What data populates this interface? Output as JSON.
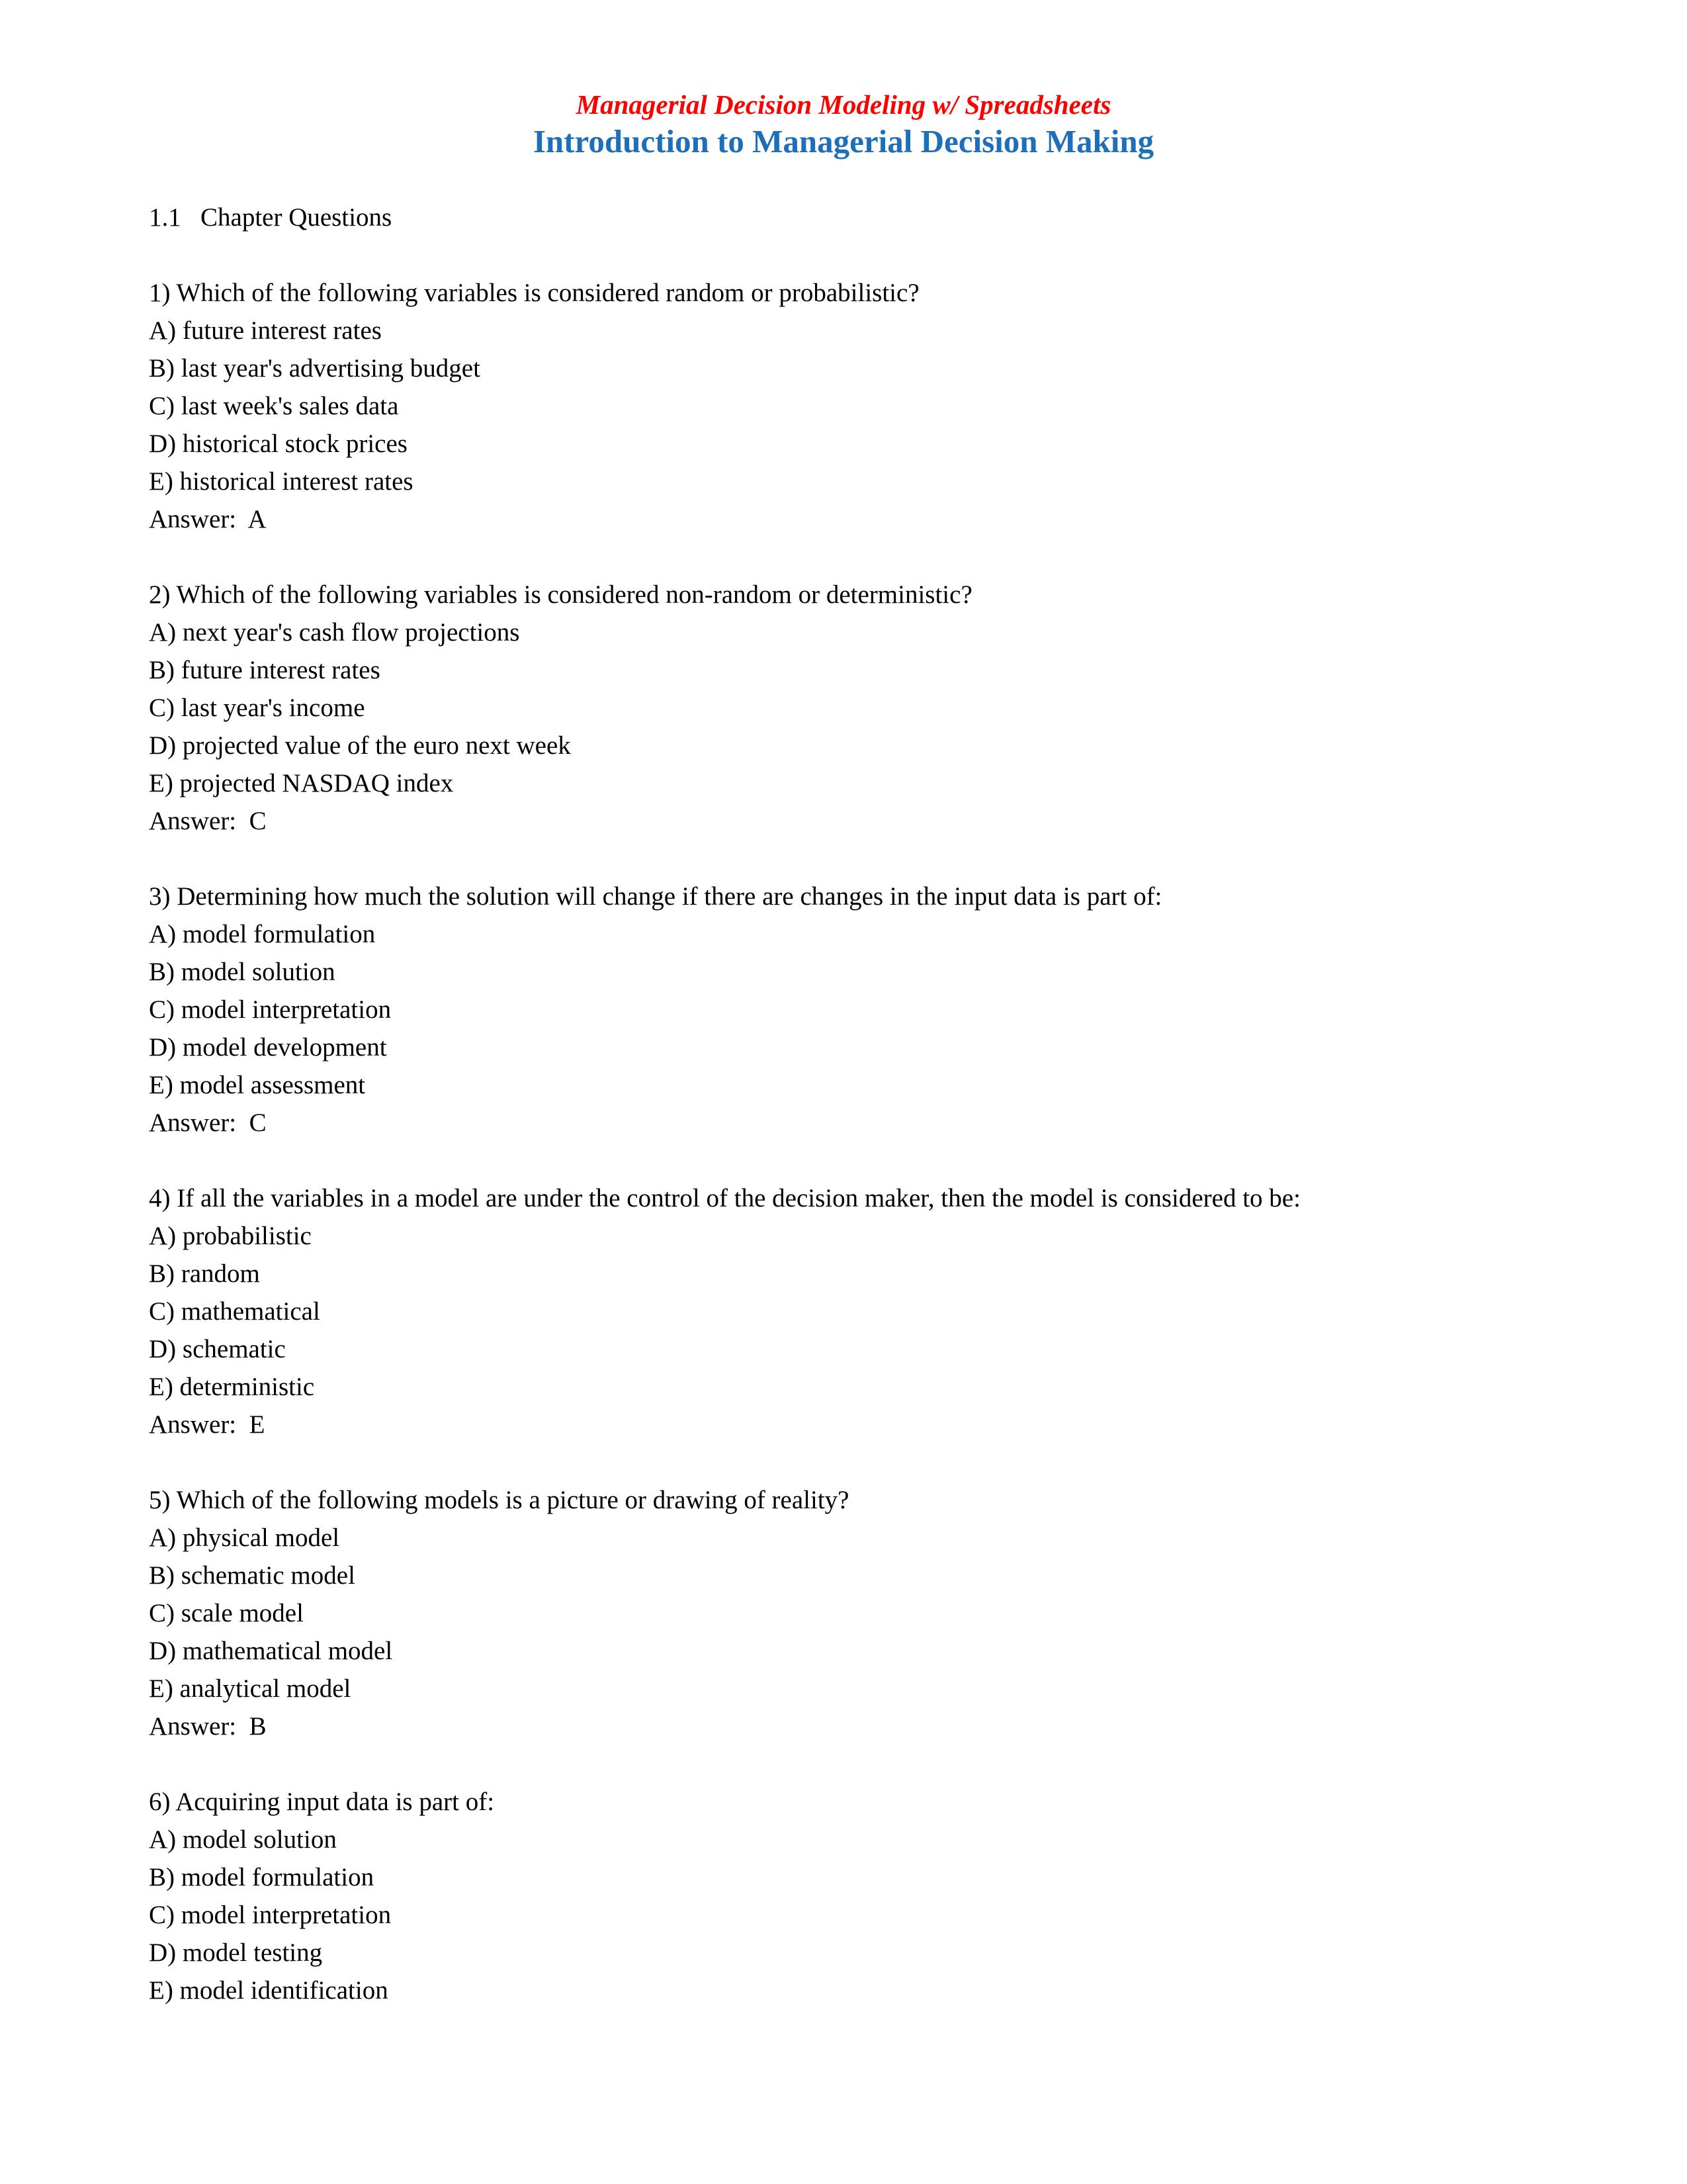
{
  "document": {
    "header": {
      "book_title": "Managerial Decision Modeling w/ Spreadsheets",
      "chapter_title": "Introduction to Managerial Decision Making",
      "book_title_color": "#FF0000",
      "chapter_title_color": "#1C6FB8"
    },
    "section": {
      "number": "1.1",
      "label": "Chapter Questions",
      "heading": "1.1   Chapter Questions"
    },
    "answer_prefix": "Answer:  ",
    "questions": [
      {
        "number": "1)",
        "stem": "1) Which of the following variables is considered random or probabilistic?",
        "options": [
          "A) future interest rates",
          "B) last year's advertising budget",
          "C) last week's sales data",
          "D) historical stock prices",
          "E) historical interest rates"
        ],
        "answer": "Answer:  A"
      },
      {
        "number": "2)",
        "stem": "2) Which of the following variables is considered non-random or deterministic?",
        "options": [
          "A) next year's cash flow projections",
          "B) future interest rates",
          "C) last year's income",
          "D) projected value of the euro next week",
          "E) projected NASDAQ index"
        ],
        "answer": "Answer:  C"
      },
      {
        "number": "3)",
        "stem": "3) Determining how much the solution will change if there are changes in the input data is part of:",
        "options": [
          "A) model formulation",
          "B) model solution",
          "C) model interpretation",
          "D) model development",
          "E) model assessment"
        ],
        "answer": "Answer:  C"
      },
      {
        "number": "4)",
        "stem": "4) If all the variables in a model are under the control of the decision maker, then the model is considered to be:",
        "options": [
          "A) probabilistic",
          "B) random",
          "C) mathematical",
          "D) schematic",
          "E) deterministic"
        ],
        "answer": "Answer:  E"
      },
      {
        "number": "5)",
        "stem": "5) Which of the following models is a picture or drawing of reality?",
        "options": [
          "A) physical model",
          "B) schematic model",
          "C) scale model",
          "D) mathematical model",
          "E) analytical model"
        ],
        "answer": "Answer:  B"
      },
      {
        "number": "6)",
        "stem": "6) Acquiring input data is part of:",
        "options": [
          "A) model solution",
          "B) model formulation",
          "C) model interpretation",
          "D) model testing",
          "E) model identification"
        ],
        "answer": ""
      }
    ]
  }
}
